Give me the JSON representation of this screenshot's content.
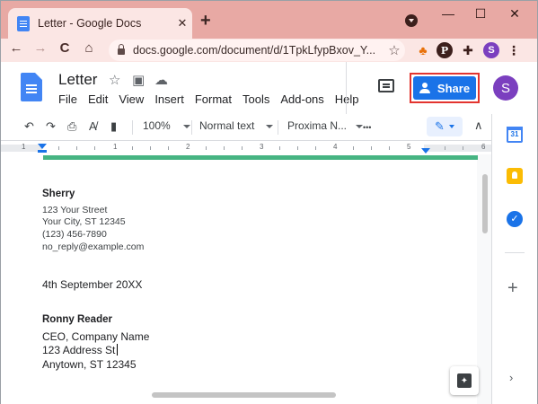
{
  "browser": {
    "tab_title": "Letter - Google Docs",
    "tab_close": "✕",
    "new_tab": "+",
    "window_controls": {
      "minimize": "—",
      "maximize": "☐",
      "close": "✕"
    },
    "nav": {
      "back": "←",
      "forward": "→",
      "reload": "C",
      "home": "⌂"
    },
    "url": "docs.google.com/document/d/1TpkLfypBxov_Y...",
    "bookmark_star": "☆",
    "extensions": {
      "leaf": "♣",
      "pinterest": "P",
      "puzzle": "✚",
      "profile": "S",
      "menu": "⋮"
    }
  },
  "docs": {
    "title": "Letter",
    "title_icons": {
      "star": "☆",
      "move": "▣",
      "cloud": "☁"
    },
    "menu": [
      "File",
      "Edit",
      "View",
      "Insert",
      "Format",
      "Tools",
      "Add-ons",
      "Help"
    ],
    "share_label": "Share",
    "user_initial": "S",
    "toolbar": {
      "undo": "↶",
      "redo": "↷",
      "print": "⎙",
      "spellcheck": "A̸",
      "paint_format": "▮",
      "zoom": "100%",
      "style": "Normal text",
      "font": "Proxima N...",
      "more": "•••",
      "edit_icon": "✎",
      "collapse": "∧"
    },
    "ruler_numbers": [
      "1",
      "1",
      "2",
      "3",
      "4",
      "5",
      "6"
    ]
  },
  "letter": {
    "sender_name": "Sherry",
    "sender_lines": [
      "123 Your Street",
      "Your City, ST 12345",
      "(123) 456-7890",
      "no_reply@example.com"
    ],
    "date": "4th September 20XX",
    "recipient_name": "Ronny Reader",
    "recipient_lines": [
      "CEO, Company Name",
      "123 Address St",
      "Anytown, ST 12345"
    ]
  },
  "side_panel": {
    "calendar": "31",
    "tasks": "✓",
    "add": "+",
    "expand": "›"
  },
  "colors": {
    "chrome_tabstrip": "#e8a9a4",
    "share_button": "#1a73e8",
    "share_highlight": "#e3342f",
    "header_bar": "#46b482",
    "avatar": "#7b3fbf"
  }
}
